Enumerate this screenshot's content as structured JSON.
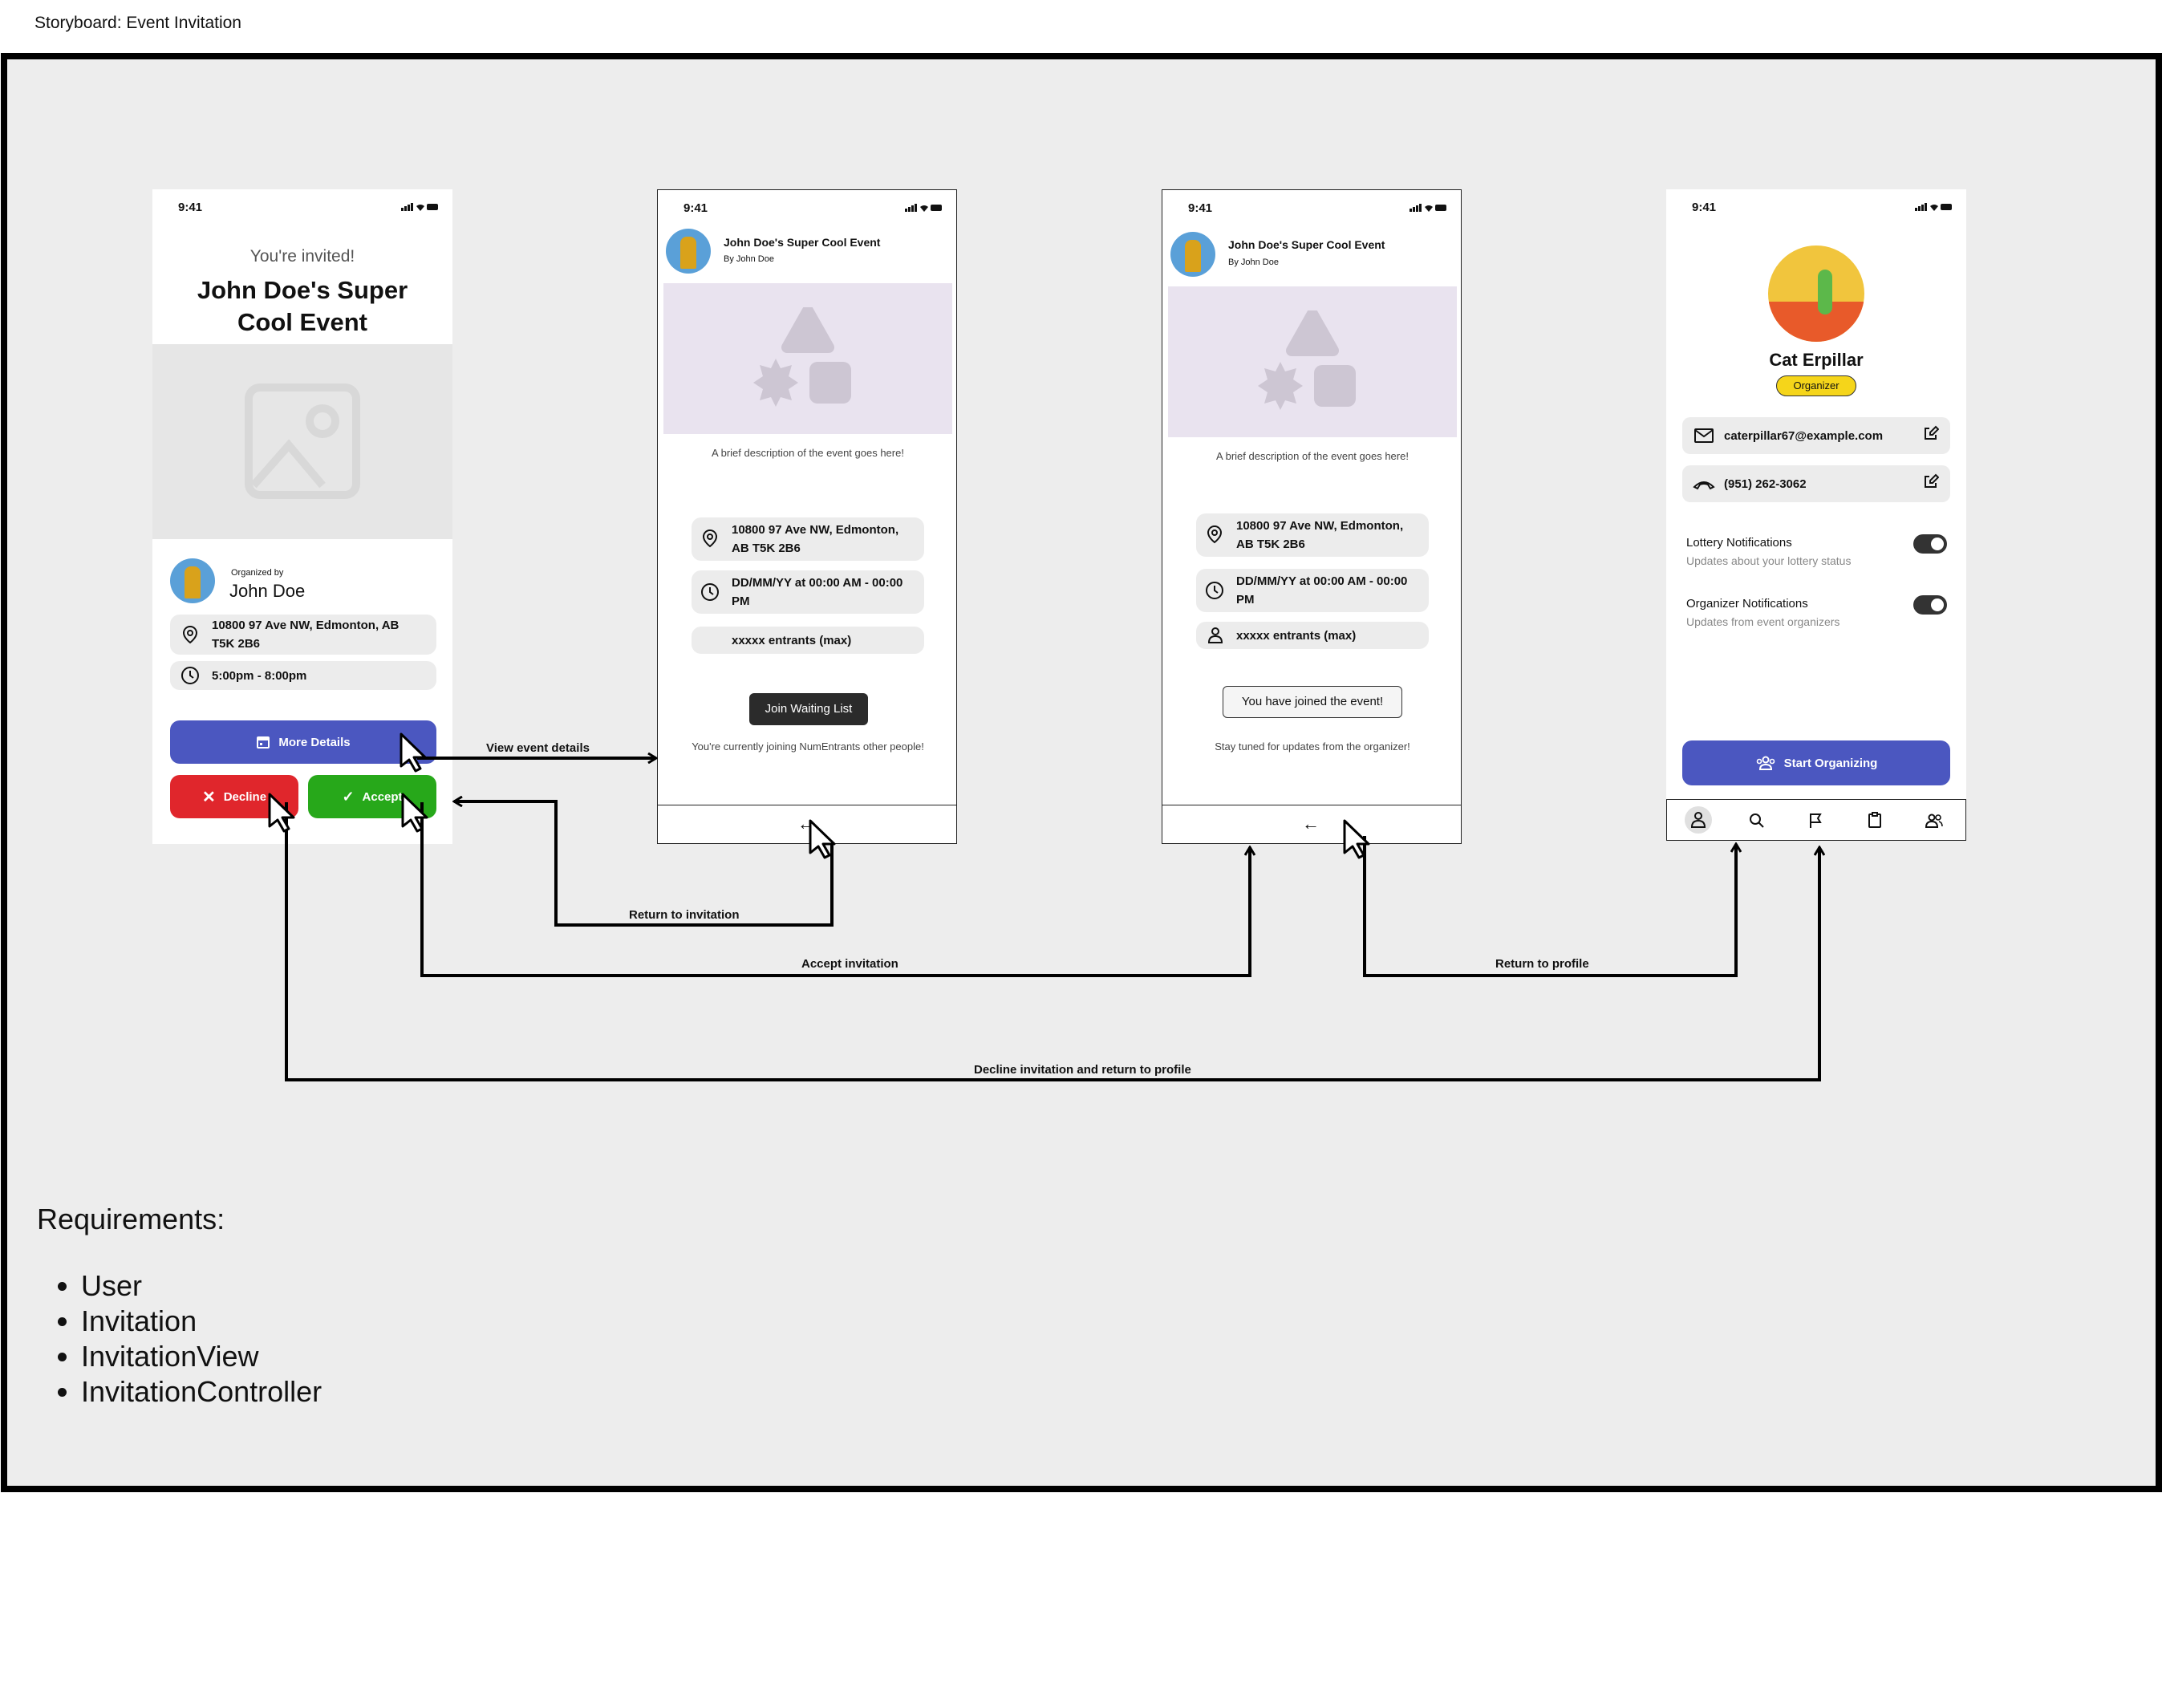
{
  "page_title": "Storyboard: Event Invitation",
  "status_time": "9:41",
  "screen1": {
    "invited": "You're invited!",
    "event_title": "John Doe's Super Cool Event",
    "organized_by": "Organized by",
    "organizer": "John Doe",
    "address": "10800 97 Ave NW, Edmonton, AB T5K 2B6",
    "time_range": "5:00pm - 8:00pm",
    "more_details": "More Details",
    "decline": "Decline",
    "accept": "Accept"
  },
  "screen2": {
    "event_title": "John Doe's Super Cool Event",
    "by": "By John Doe",
    "description": "A brief description of the event goes here!",
    "address": "10800 97 Ave NW, Edmonton, AB T5K 2B6",
    "datetime": "DD/MM/YY at 00:00 AM - 00:00 PM",
    "entrants": "xxxxx entrants (max)",
    "join_button": "Join Waiting List",
    "joining_note": "You're currently joining NumEntrants other people!"
  },
  "screen3": {
    "event_title": "John Doe's Super Cool Event",
    "by": "By John Doe",
    "description": "A brief description of the event goes here!",
    "address": "10800 97 Ave NW, Edmonton, AB T5K 2B6",
    "datetime": "DD/MM/YY at 00:00 AM - 00:00 PM",
    "entrants": "xxxxx entrants (max)",
    "joined_badge": "You have joined the event!",
    "stay_tuned": "Stay tuned for updates from the organizer!"
  },
  "screen4": {
    "name": "Cat Erpillar",
    "role": "Organizer",
    "email": "caterpillar67@example.com",
    "phone": "(951) 262-3062",
    "lottery_title": "Lottery Notifications",
    "lottery_sub": "Updates about your lottery status",
    "organizer_title": "Organizer Notifications",
    "organizer_sub": "Updates from event organizers",
    "start_button": "Start Organizing",
    "nav_icons": [
      "person-icon",
      "search-icon",
      "flag-icon",
      "clipboard-icon",
      "people-icon"
    ]
  },
  "flow_labels": {
    "view_details": "View event details",
    "return_invitation": "Return to invitation",
    "accept_invitation": "Accept invitation",
    "return_profile": "Return to profile",
    "decline_return": "Decline invitation and return to profile"
  },
  "requirements": {
    "heading": "Requirements:",
    "items": [
      "User",
      "Invitation",
      "InvitationView",
      "InvitationController"
    ]
  },
  "colors": {
    "board_bg": "#ededed",
    "primary": "#4b57c0",
    "decline": "#e0262c",
    "accept": "#27a81a",
    "organizer_badge": "#f5d51a",
    "image_placeholder": "#e9e3ef"
  }
}
